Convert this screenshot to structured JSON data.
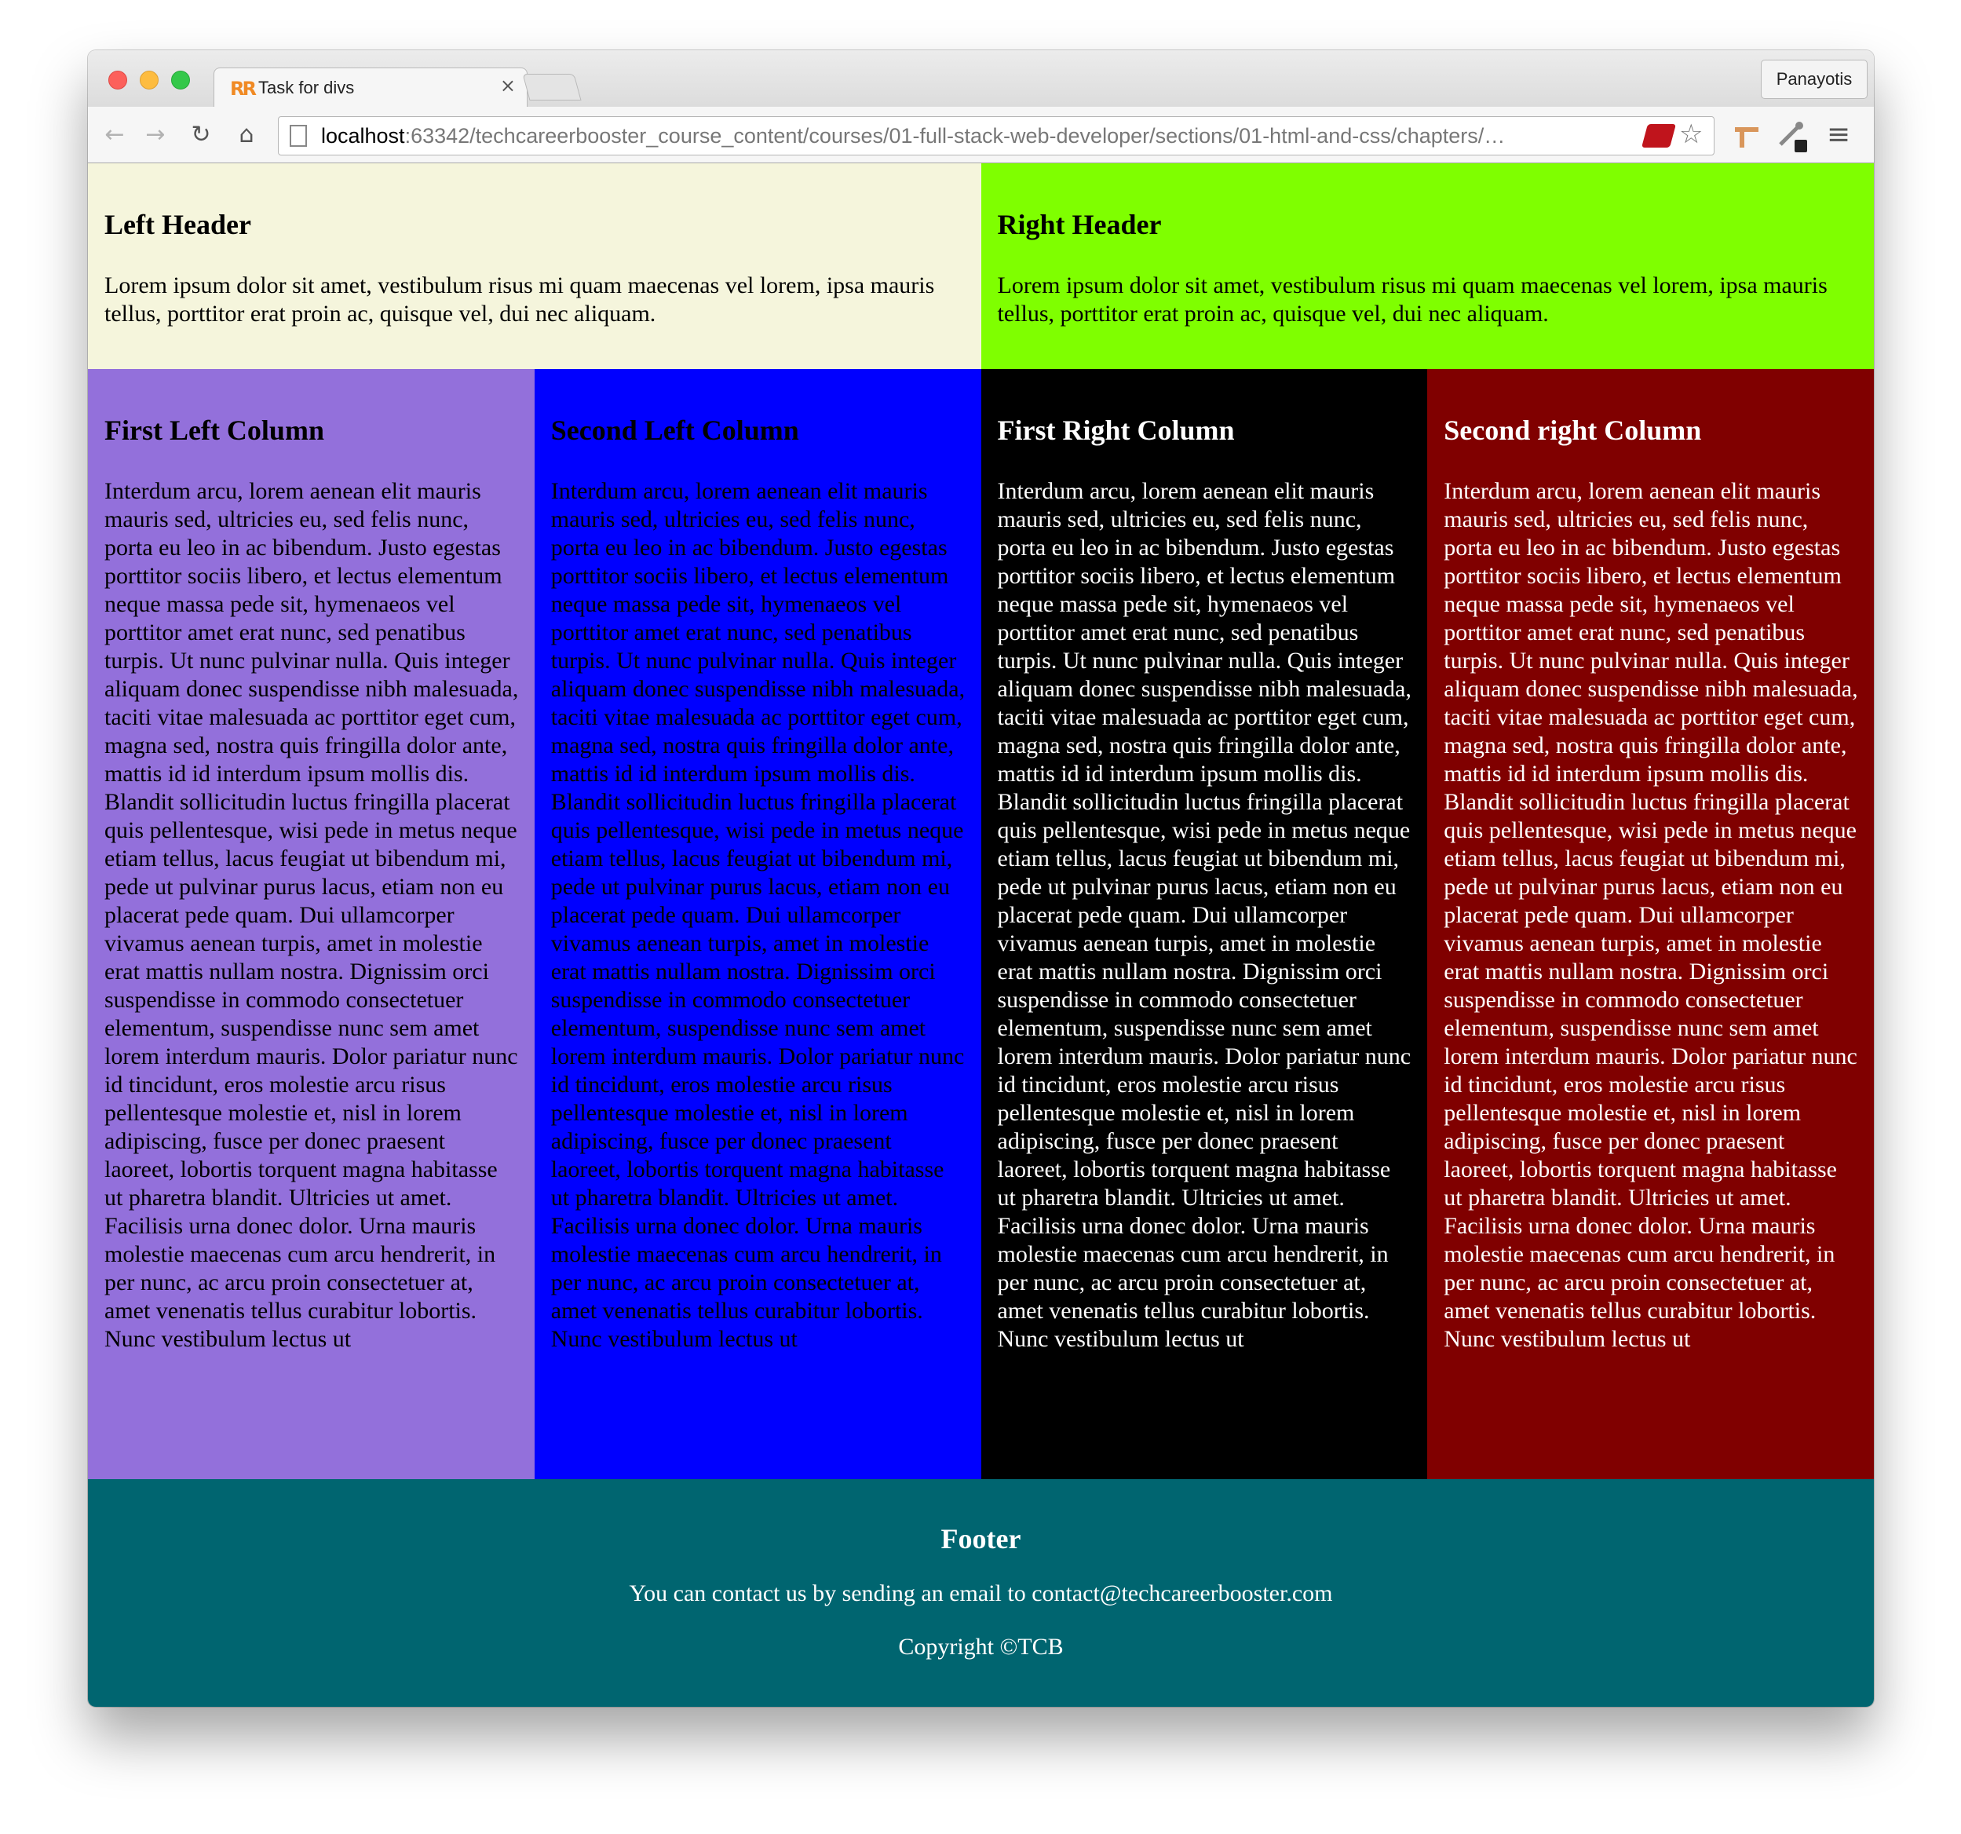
{
  "browser": {
    "tab_title": "Task for divs",
    "tab_close": "×",
    "profile_name": "Panayotis",
    "url_host": "localhost",
    "url_rest": ":63342/techcareerbooster_course_content/courses/01-full-stack-web-developer/sections/01-html-and-css/chapters/…",
    "icons": {
      "back": "←",
      "forward": "→",
      "reload": "↻",
      "home": "⌂",
      "star": "☆",
      "menu": "≡"
    }
  },
  "header": {
    "left": {
      "title": "Left Header",
      "text": "Lorem ipsum dolor sit amet, vestibulum risus mi quam maecenas vel lorem, ipsa mauris tellus, porttitor erat proin ac, quisque vel, dui nec aliquam."
    },
    "right": {
      "title": "Right Header",
      "text": "Lorem ipsum dolor sit amet, vestibulum risus mi quam maecenas vel lorem, ipsa mauris tellus, porttitor erat proin ac, quisque vel, dui nec aliquam."
    }
  },
  "columns": [
    {
      "title": "First Left Column",
      "text": "Interdum arcu, lorem aenean elit mauris mauris sed, ultricies eu, sed felis nunc, porta eu leo in ac bibendum. Justo egestas porttitor sociis libero, et lectus elementum neque massa pede sit, hymenaeos vel porttitor amet erat nunc, sed penatibus turpis. Ut nunc pulvinar nulla. Quis integer aliquam donec suspendisse nibh malesuada, taciti vitae malesuada ac porttitor eget cum, magna sed, nostra quis fringilla dolor ante, mattis id id interdum ipsum mollis dis. Blandit sollicitudin luctus fringilla placerat quis pellentesque, wisi pede in metus neque etiam tellus, lacus feugiat ut bibendum mi, pede ut pulvinar purus lacus, etiam non eu placerat pede quam. Dui ullamcorper vivamus aenean turpis, amet in molestie erat mattis nullam nostra. Dignissim orci suspendisse in commodo consectetuer elementum, suspendisse nunc sem amet lorem interdum mauris. Dolor pariatur nunc id tincidunt, eros molestie arcu risus pellentesque molestie et, nisl in lorem adipiscing, fusce per donec praesent laoreet, lobortis torquent magna habitasse ut pharetra blandit. Ultricies ut amet. Facilisis urna donec dolor. Urna mauris molestie maecenas cum arcu hendrerit, in per nunc, ac arcu proin consectetuer at, amet venenatis tellus curabitur lobortis. Nunc vestibulum lectus ut"
    },
    {
      "title": "Second Left Column",
      "text": "Interdum arcu, lorem aenean elit mauris mauris sed, ultricies eu, sed felis nunc, porta eu leo in ac bibendum. Justo egestas porttitor sociis libero, et lectus elementum neque massa pede sit, hymenaeos vel porttitor amet erat nunc, sed penatibus turpis. Ut nunc pulvinar nulla. Quis integer aliquam donec suspendisse nibh malesuada, taciti vitae malesuada ac porttitor eget cum, magna sed, nostra quis fringilla dolor ante, mattis id id interdum ipsum mollis dis. Blandit sollicitudin luctus fringilla placerat quis pellentesque, wisi pede in metus neque etiam tellus, lacus feugiat ut bibendum mi, pede ut pulvinar purus lacus, etiam non eu placerat pede quam. Dui ullamcorper vivamus aenean turpis, amet in molestie erat mattis nullam nostra. Dignissim orci suspendisse in commodo consectetuer elementum, suspendisse nunc sem amet lorem interdum mauris. Dolor pariatur nunc id tincidunt, eros molestie arcu risus pellentesque molestie et, nisl in lorem adipiscing, fusce per donec praesent laoreet, lobortis torquent magna habitasse ut pharetra blandit. Ultricies ut amet. Facilisis urna donec dolor. Urna mauris molestie maecenas cum arcu hendrerit, in per nunc, ac arcu proin consectetuer at, amet venenatis tellus curabitur lobortis. Nunc vestibulum lectus ut"
    },
    {
      "title": "First Right Column",
      "text": "Interdum arcu, lorem aenean elit mauris mauris sed, ultricies eu, sed felis nunc, porta eu leo in ac bibendum. Justo egestas porttitor sociis libero, et lectus elementum neque massa pede sit, hymenaeos vel porttitor amet erat nunc, sed penatibus turpis. Ut nunc pulvinar nulla. Quis integer aliquam donec suspendisse nibh malesuada, taciti vitae malesuada ac porttitor eget cum, magna sed, nostra quis fringilla dolor ante, mattis id id interdum ipsum mollis dis. Blandit sollicitudin luctus fringilla placerat quis pellentesque, wisi pede in metus neque etiam tellus, lacus feugiat ut bibendum mi, pede ut pulvinar purus lacus, etiam non eu placerat pede quam. Dui ullamcorper vivamus aenean turpis, amet in molestie erat mattis nullam nostra. Dignissim orci suspendisse in commodo consectetuer elementum, suspendisse nunc sem amet lorem interdum mauris. Dolor pariatur nunc id tincidunt, eros molestie arcu risus pellentesque molestie et, nisl in lorem adipiscing, fusce per donec praesent laoreet, lobortis torquent magna habitasse ut pharetra blandit. Ultricies ut amet. Facilisis urna donec dolor. Urna mauris molestie maecenas cum arcu hendrerit, in per nunc, ac arcu proin consectetuer at, amet venenatis tellus curabitur lobortis. Nunc vestibulum lectus ut"
    },
    {
      "title": "Second right Column",
      "text": "Interdum arcu, lorem aenean elit mauris mauris sed, ultricies eu, sed felis nunc, porta eu leo in ac bibendum. Justo egestas porttitor sociis libero, et lectus elementum neque massa pede sit, hymenaeos vel porttitor amet erat nunc, sed penatibus turpis. Ut nunc pulvinar nulla. Quis integer aliquam donec suspendisse nibh malesuada, taciti vitae malesuada ac porttitor eget cum, magna sed, nostra quis fringilla dolor ante, mattis id id interdum ipsum mollis dis. Blandit sollicitudin luctus fringilla placerat quis pellentesque, wisi pede in metus neque etiam tellus, lacus feugiat ut bibendum mi, pede ut pulvinar purus lacus, etiam non eu placerat pede quam. Dui ullamcorper vivamus aenean turpis, amet in molestie erat mattis nullam nostra. Dignissim orci suspendisse in commodo consectetuer elementum, suspendisse nunc sem amet lorem interdum mauris. Dolor pariatur nunc id tincidunt, eros molestie arcu risus pellentesque molestie et, nisl in lorem adipiscing, fusce per donec praesent laoreet, lobortis torquent magna habitasse ut pharetra blandit. Ultricies ut amet. Facilisis urna donec dolor. Urna mauris molestie maecenas cum arcu hendrerit, in per nunc, ac arcu proin consectetuer at, amet venenatis tellus curabitur lobortis. Nunc vestibulum lectus ut"
    }
  ],
  "footer": {
    "title": "Footer",
    "contact": "You can contact us by sending an email to contact@techcareerbooster.com",
    "copyright": "Copyright ©TCB"
  },
  "colors": {
    "left_header_bg": "#f5f5dc",
    "right_header_bg": "#7fff00",
    "col1_bg": "#9370db",
    "col2_bg": "#0000ff",
    "col3_bg": "#000000",
    "col4_bg": "#800000",
    "footer_bg": "#006570"
  }
}
